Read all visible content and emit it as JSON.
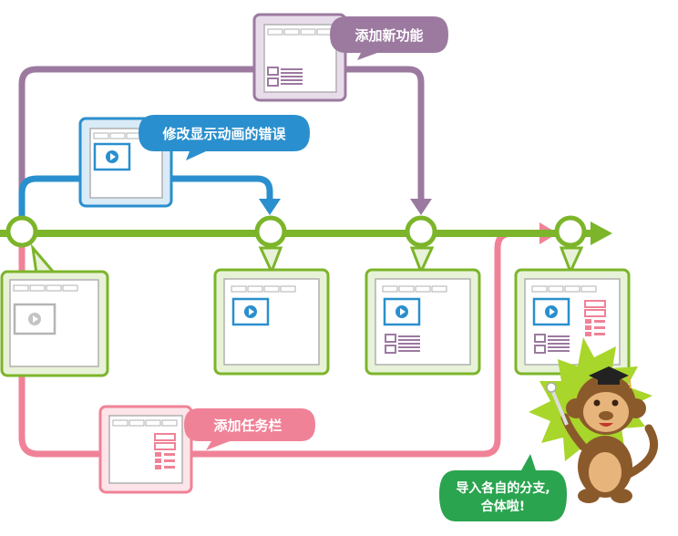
{
  "callouts": {
    "feature": "添加新功能",
    "fix": "修改显示动画的错误",
    "taskbar": "添加任务栏",
    "merge_line1": "导入各自的分支,",
    "merge_line2": "合体啦!"
  },
  "colors": {
    "main_branch": "#7cb52a",
    "feature_branch": "#9c7aa0",
    "fix_branch": "#2a8fce",
    "taskbar_branch": "#f08297",
    "merge_bubble": "#2aa44f",
    "monkey": "#8b5a2b"
  },
  "icons": [
    "mortarboard-icon",
    "pointer-stick-icon",
    "play-icon"
  ]
}
